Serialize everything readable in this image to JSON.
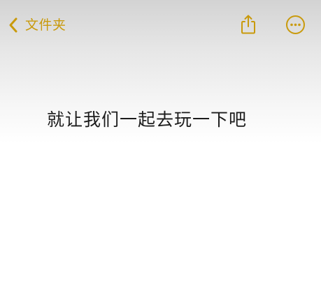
{
  "nav": {
    "back_label": "文件夹",
    "back_icon": "chevron-left-icon",
    "share_icon": "share-icon",
    "more_icon": "more-icon"
  },
  "note": {
    "body": "就让我们一起去玩一下吧"
  },
  "colors": {
    "accent": "#c99a0c",
    "text": "#1c1c1c",
    "background": "#ffffff"
  }
}
